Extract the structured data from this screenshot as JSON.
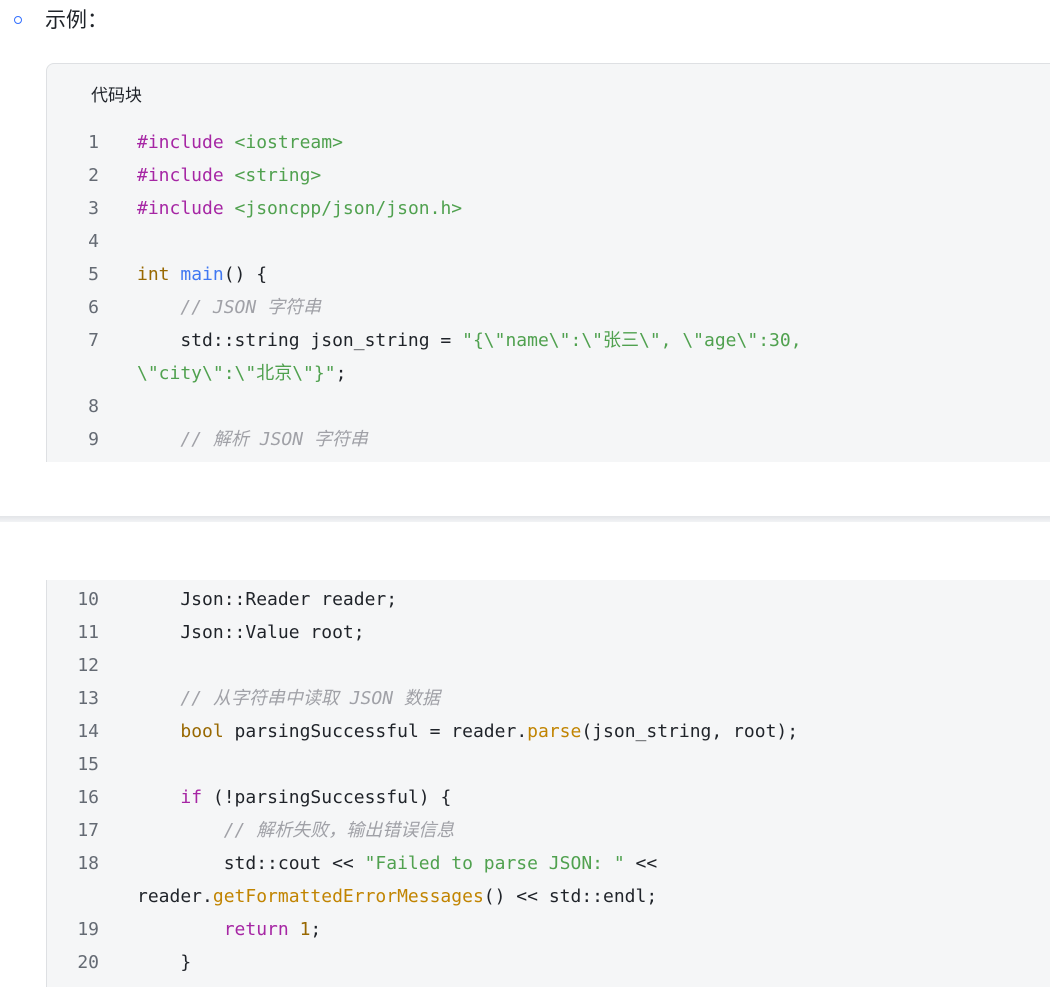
{
  "bullet": {
    "label": "示例："
  },
  "code_block": {
    "title": "代码块",
    "lines": [
      {
        "n": "1",
        "tokens": [
          {
            "t": "#include",
            "c": "kw"
          },
          {
            "t": " "
          },
          {
            "t": "<iostream>",
            "c": "str"
          }
        ]
      },
      {
        "n": "2",
        "tokens": [
          {
            "t": "#include",
            "c": "kw"
          },
          {
            "t": " "
          },
          {
            "t": "<string>",
            "c": "str"
          }
        ]
      },
      {
        "n": "3",
        "tokens": [
          {
            "t": "#include",
            "c": "kw"
          },
          {
            "t": " "
          },
          {
            "t": "<jsoncpp/json/json.h>",
            "c": "str"
          }
        ]
      },
      {
        "n": "4",
        "tokens": []
      },
      {
        "n": "5",
        "tokens": [
          {
            "t": "int",
            "c": "type"
          },
          {
            "t": " "
          },
          {
            "t": "main",
            "c": "fn"
          },
          {
            "t": "() {"
          }
        ]
      },
      {
        "n": "6",
        "tokens": [
          {
            "t": "    "
          },
          {
            "t": "// JSON 字符串",
            "c": "cmt"
          }
        ]
      },
      {
        "n": "7",
        "tokens": [
          {
            "t": "    std::string json_string = "
          },
          {
            "t": "\"{\\\"name\\\":\\\"张三\\\", \\\"age\\\":30,",
            "c": "str"
          }
        ]
      },
      {
        "n": "",
        "tokens": [
          {
            "t": "\\\"city\\\":\\\"北京\\\"}\"",
            "c": "str"
          },
          {
            "t": ";"
          }
        ]
      },
      {
        "n": "8",
        "tokens": []
      },
      {
        "n": "9",
        "tokens": [
          {
            "t": "    "
          },
          {
            "t": "// 解析 JSON 字符串",
            "c": "cmt"
          }
        ]
      },
      {
        "n": "10",
        "tokens": [
          {
            "t": "    Json::Reader reader;"
          }
        ]
      },
      {
        "n": "11",
        "tokens": [
          {
            "t": "    Json::Value root;"
          }
        ]
      },
      {
        "n": "12",
        "tokens": []
      },
      {
        "n": "13",
        "tokens": [
          {
            "t": "    "
          },
          {
            "t": "// 从字符串中读取 JSON 数据",
            "c": "cmt"
          }
        ]
      },
      {
        "n": "14",
        "tokens": [
          {
            "t": "    "
          },
          {
            "t": "bool",
            "c": "type"
          },
          {
            "t": " parsingSuccessful = reader."
          },
          {
            "t": "parse",
            "c": "method"
          },
          {
            "t": "(json_string, root);"
          }
        ]
      },
      {
        "n": "15",
        "tokens": []
      },
      {
        "n": "16",
        "tokens": [
          {
            "t": "    "
          },
          {
            "t": "if",
            "c": "kw"
          },
          {
            "t": " (!parsingSuccessful) {"
          }
        ]
      },
      {
        "n": "17",
        "tokens": [
          {
            "t": "        "
          },
          {
            "t": "// 解析失败，输出错误信息",
            "c": "cmt"
          }
        ]
      },
      {
        "n": "18",
        "tokens": [
          {
            "t": "        std::cout << "
          },
          {
            "t": "\"Failed to parse JSON: \"",
            "c": "str"
          },
          {
            "t": " <<"
          }
        ]
      },
      {
        "n": "",
        "tokens": [
          {
            "t": "reader."
          },
          {
            "t": "getFormattedErrorMessages",
            "c": "method"
          },
          {
            "t": "() << std::endl;"
          }
        ]
      },
      {
        "n": "19",
        "tokens": [
          {
            "t": "        "
          },
          {
            "t": "return",
            "c": "kw"
          },
          {
            "t": " "
          },
          {
            "t": "1",
            "c": "num"
          },
          {
            "t": ";"
          }
        ]
      },
      {
        "n": "20",
        "tokens": [
          {
            "t": "    }"
          }
        ]
      }
    ]
  }
}
